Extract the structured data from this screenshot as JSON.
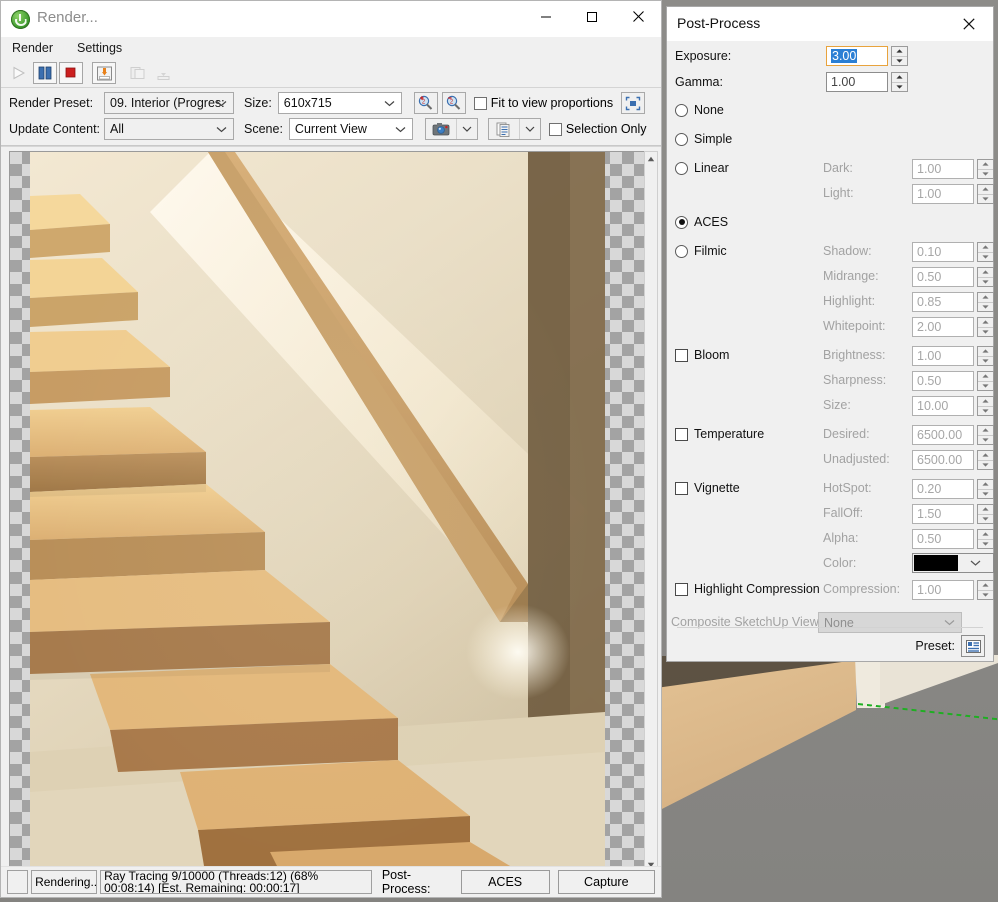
{
  "render_window": {
    "title": "Render...",
    "title_icon": "thea-render-power-icon",
    "window_buttons": {
      "minimize": "minimize-icon",
      "maximize": "maximize-icon",
      "close": "close-icon"
    },
    "menu": [
      "Render",
      "Settings"
    ],
    "toolbar": [
      {
        "name": "start-render-button",
        "icon": "play-icon",
        "enabled": false
      },
      {
        "name": "pause-render-button",
        "icon": "pause-icon",
        "enabled": true
      },
      {
        "name": "stop-render-button",
        "icon": "stop-icon",
        "enabled": true
      },
      {
        "name": "save-image-button",
        "icon": "save-down-arrow-icon",
        "enabled": true
      },
      {
        "name": "load-image-button",
        "icon": "load-image-icon",
        "enabled": false
      },
      {
        "name": "merge-image-button",
        "icon": "merge-down-icon",
        "enabled": false
      }
    ],
    "options": {
      "render_preset_label": "Render Preset:",
      "render_preset_value": "09. Interior (Progres:",
      "size_label": "Size:",
      "size_value": "610x715",
      "update_content_label": "Update Content:",
      "update_content_value": "All",
      "scene_label": "Scene:",
      "scene_value": "Current View",
      "zoom_in_icon": "zoom-in-magnifier-icon",
      "zoom_out_icon": "zoom-out-magnifier-icon",
      "fit_to_view_label": "Fit to view proportions",
      "fit_to_view_checked": false,
      "fit_region_icon": "fit-region-icon",
      "camera_icon": "camera-icon",
      "layers_icon": "layers-icon",
      "selection_only_label": "Selection Only",
      "selection_only_checked": false
    },
    "status": {
      "state": "Rendering...",
      "message": "Ray Tracing 9/10000 (Threads:12) (68% 00:08:14) [Est. Remaining: 00:00:17]",
      "post_process_label": "Post-Process:",
      "post_process_button": "ACES",
      "capture_button": "Capture"
    }
  },
  "post_process": {
    "title": "Post-Process",
    "close_icon": "close-icon",
    "exposure_label": "Exposure:",
    "exposure_value": "3.00",
    "gamma_label": "Gamma:",
    "gamma_value": "1.00",
    "tonemap_options": [
      {
        "label": "None",
        "selected": false
      },
      {
        "label": "Simple",
        "selected": false
      },
      {
        "label": "Linear",
        "selected": false
      },
      {
        "label": "ACES",
        "selected": true
      },
      {
        "label": "Filmic",
        "selected": false
      }
    ],
    "linear_fields": [
      {
        "label": "Dark:",
        "value": "1.00"
      },
      {
        "label": "Light:",
        "value": "1.00"
      }
    ],
    "filmic_fields": [
      {
        "label": "Shadow:",
        "value": "0.10"
      },
      {
        "label": "Midrange:",
        "value": "0.50"
      },
      {
        "label": "Highlight:",
        "value": "0.85"
      },
      {
        "label": "Whitepoint:",
        "value": "2.00"
      }
    ],
    "bloom_label": "Bloom",
    "bloom_checked": false,
    "bloom_fields": [
      {
        "label": "Brightness:",
        "value": "1.00"
      },
      {
        "label": "Sharpness:",
        "value": "0.50"
      },
      {
        "label": "Size:",
        "value": "10.00"
      }
    ],
    "temperature_label": "Temperature",
    "temperature_checked": false,
    "temperature_fields": [
      {
        "label": "Desired:",
        "value": "6500.00"
      },
      {
        "label": "Unadjusted:",
        "value": "6500.00"
      }
    ],
    "vignette_label": "Vignette",
    "vignette_checked": false,
    "vignette_fields": [
      {
        "label": "HotSpot:",
        "value": "0.20"
      },
      {
        "label": "FallOff:",
        "value": "1.50"
      },
      {
        "label": "Alpha:",
        "value": "0.50"
      }
    ],
    "color_label": "Color:",
    "color_value": "#000000",
    "highlight_compression_label": "Highlight Compression",
    "highlight_compression_checked": false,
    "compression_label": "Compression:",
    "compression_value": "1.00",
    "composite_label": "Composite SketchUp View:",
    "composite_value": "None",
    "preset_label": "Preset:",
    "preset_icon": "preset-list-icon"
  },
  "colors": {
    "accent_blue": "#2b7fd4",
    "focus_orange": "#e8a33d",
    "window_bg": "#f0f0f0",
    "axis_green": "#1eaf22"
  }
}
